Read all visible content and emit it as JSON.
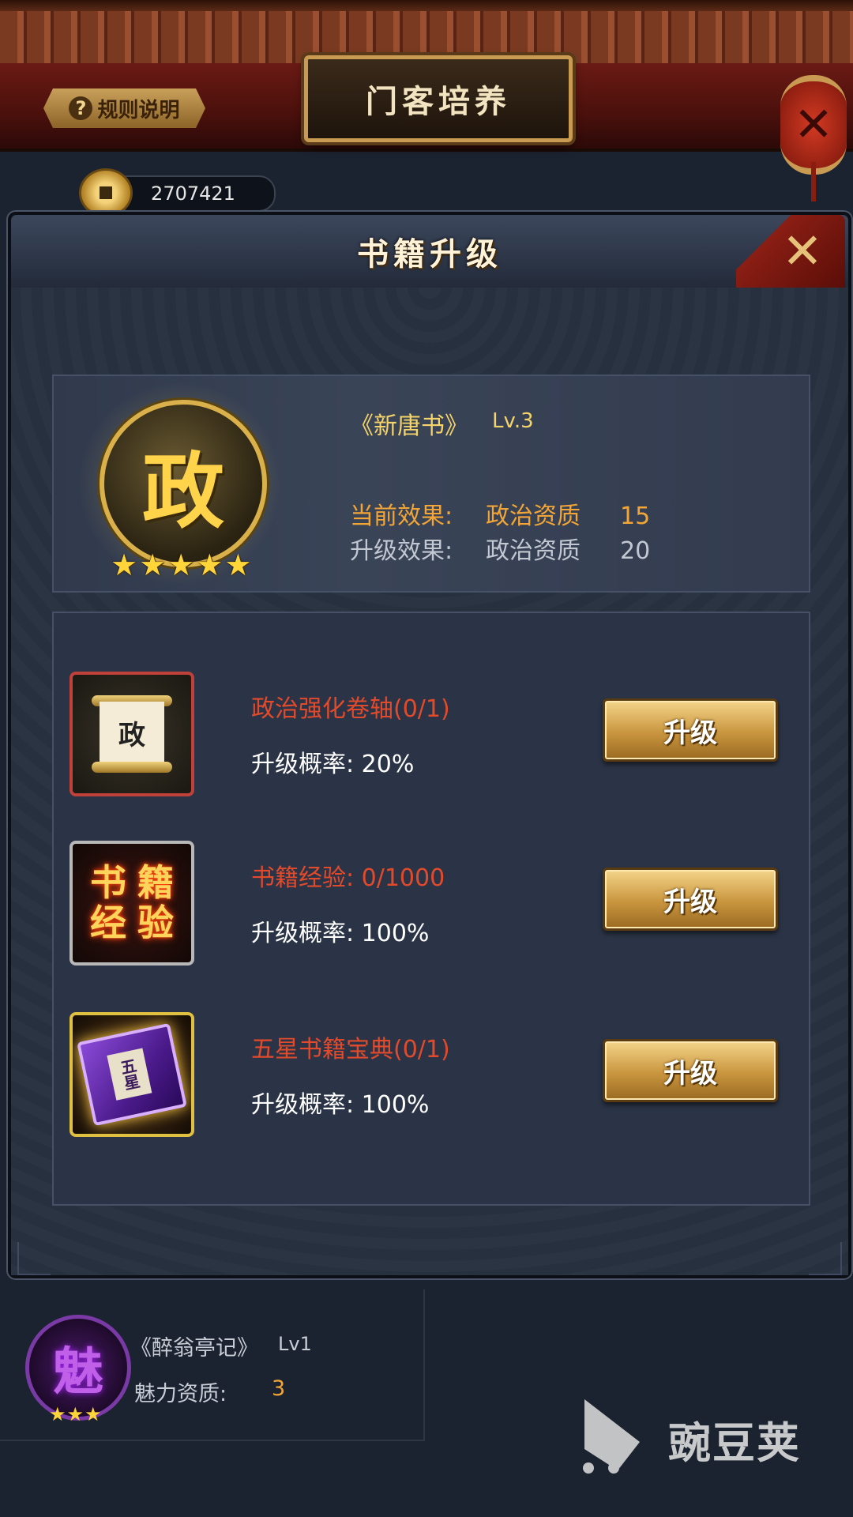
{
  "header": {
    "rules_label": "规则说明",
    "title": "门客培养",
    "close_glyph": "✕"
  },
  "currency": {
    "amount": "2707421"
  },
  "modal": {
    "title": "书籍升级",
    "close_glyph": "✕",
    "book": {
      "icon_char": "政",
      "stars": [
        "★",
        "★",
        "★",
        "★",
        "★"
      ],
      "name": "《新唐书》",
      "level": "Lv.3",
      "current_label": "当前效果:",
      "current_attr": "政治资质",
      "current_value": "15",
      "next_label": "升级效果:",
      "next_attr": "政治资质",
      "next_value": "20"
    },
    "items": [
      {
        "name": "政治强化卷轴(0/1)",
        "rate": "升级概率: 20%",
        "button": "升级",
        "icon_char": "政",
        "icon": "scroll-icon"
      },
      {
        "name": "书籍经验: 0/1000",
        "rate": "升级概率: 100%",
        "button": "升级",
        "icon_chars": [
          "书",
          "籍",
          "经",
          "验"
        ],
        "icon": "book-exp-icon"
      },
      {
        "name": "五星书籍宝典(0/1)",
        "rate": "升级概率: 100%",
        "button": "升级",
        "icon_char": "五星",
        "icon": "five-star-tome-icon"
      }
    ]
  },
  "bottom_book": {
    "icon_char": "魅",
    "stars": [
      "★",
      "★",
      "★"
    ],
    "name": "《醉翁亭记》",
    "level": "Lv1",
    "attr": "魅力资质:",
    "value": "3"
  },
  "watermark": {
    "text": "豌豆荚"
  }
}
